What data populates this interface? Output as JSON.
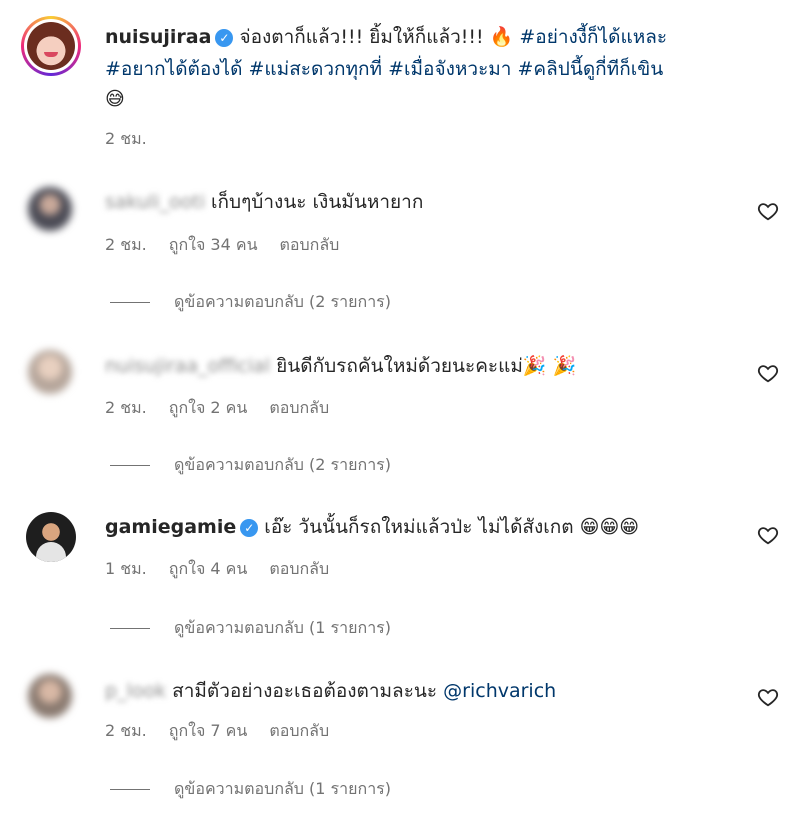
{
  "post": {
    "username": "nuisujiraa",
    "caption_text": "จ่องตาก็แล้ว!!! ยิ้มให้ก็แล้ว!!! 🔥",
    "hashtags_line1": "#อย่างงี้ก็ได้แหละ",
    "hashtags_line2": [
      "#อยากได้ต้องได้",
      "#แม่สะดวกทุกที่",
      "#เมื่อจังหวะมา",
      "#คลิปนี้ดูกี่ทีก็เขิน"
    ],
    "caption_emoji": "😅",
    "time": "2 ชม."
  },
  "comments": [
    {
      "username": "sakuli_ooti",
      "text": "เก็บๆบ้างนะ เงินมันหายาก",
      "time": "2 ชม.",
      "likes": "ถูกใจ 34 คน",
      "reply_label": "ตอบกลับ",
      "view_replies": "ดูข้อความตอบกลับ (2 รายการ)"
    },
    {
      "username": "nuisujiraa_official",
      "text": "ยินดีกับรถคันใหม่ด้วยนะคะแม่🎉 🎉",
      "time": "2 ชม.",
      "likes": "ถูกใจ 2 คน",
      "reply_label": "ตอบกลับ",
      "view_replies": "ดูข้อความตอบกลับ (2 รายการ)"
    },
    {
      "username": "gamiegamie",
      "text": "เอ๊ะ วันนั้นก็รถใหม่แล้วป่ะ ไม่ได้สังเกต 😁😁😁",
      "time": "1 ชม.",
      "likes": "ถูกใจ 4 คน",
      "reply_label": "ตอบกลับ",
      "view_replies": "ดูข้อความตอบกลับ (1 รายการ)"
    },
    {
      "username": "p_look",
      "text": "สามีตัวอย่างอะเธอต้องตามละนะ",
      "mention": "@richvarich",
      "time": "2 ชม.",
      "likes": "ถูกใจ 7 คน",
      "reply_label": "ตอบกลับ",
      "view_replies": "ดูข้อความตอบกลับ (1 รายการ)"
    }
  ],
  "colors": {
    "link": "#00376b",
    "verified": "#3897f0",
    "meta": "#737373"
  }
}
